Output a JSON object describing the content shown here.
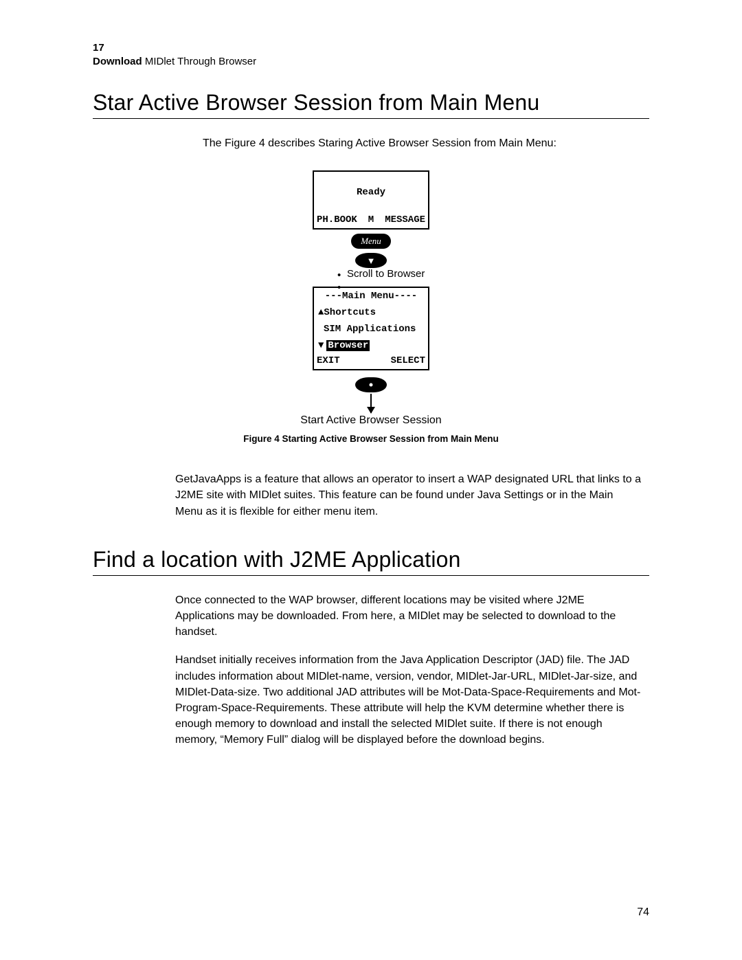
{
  "header": {
    "chapter": "17",
    "title_bold": "Download",
    "title_rest": " MIDlet Through Browser"
  },
  "section1": {
    "heading": "Star Active Browser Session from Main Menu",
    "intro": "The Figure 4 describes Staring Active Browser Session from Main Menu:"
  },
  "figure": {
    "screen1": {
      "ready": "Ready",
      "left": "PH.BOOK",
      "mid": "M",
      "right": "MESSAGE"
    },
    "menu_button": "Menu",
    "scroll_label": "Scroll to Browser",
    "screen2": {
      "title": "---Main Menu----",
      "item1": "Shortcuts",
      "item2": "SIM Applications",
      "item3_hl": "Browser",
      "soft_left": "EXIT",
      "soft_right": "SELECT"
    },
    "start_label": "Start Active Browser Session",
    "caption": "Figure 4 Starting Active Browser Session from Main Menu"
  },
  "para1": "GetJavaApps is a feature that allows an operator to insert a WAP designated URL that links to a J2ME site with MIDlet suites. This feature can be found under Java Settings or in the Main Menu as it is flexible for either menu item.",
  "section2": {
    "heading": "Find a location with J2ME Application",
    "p1": "Once connected to the WAP browser, different locations may be visited where J2ME Applications may be downloaded. From here, a MIDlet may be selected to download to the handset.",
    "p2": "Handset initially receives information from the Java Application Descriptor (JAD) file. The JAD includes information about MIDlet-name, version, vendor, MIDlet-Jar-URL, MIDlet-Jar-size, and MIDlet-Data-size. Two additional JAD attributes will be Mot-Data-Space-Requirements and Mot-Program-Space-Requirements. These attribute will help the KVM determine whether there is enough memory to download and install the selected MIDlet suite. If there is not enough memory, “Memory Full” dialog will be displayed before the download begins."
  },
  "page_number": "74"
}
